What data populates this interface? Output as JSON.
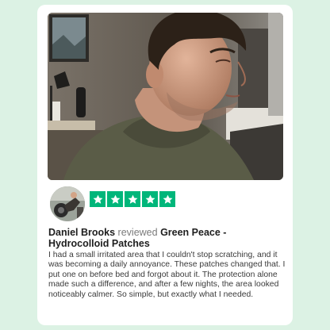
{
  "review": {
    "reviewer_name": "Daniel Brooks",
    "verb": "reviewed",
    "product_name": "Green Peace - Hydrocolloid Patches",
    "rating": 5,
    "rating_max": 5,
    "body": "I had a small irritated area that I couldn't stop scratching, and it was becoming a daily annoyance. These patches changed that. I put one on before bed and forgot about it. The protection alone made such a difference, and after a few nights, the area looked noticeably calmer. So simple, but exactly what I needed."
  },
  "colors": {
    "page_background": "#dcf2e4",
    "star_green": "#00b67a",
    "card": "#ffffff"
  },
  "icons": {
    "star": "star-icon"
  }
}
